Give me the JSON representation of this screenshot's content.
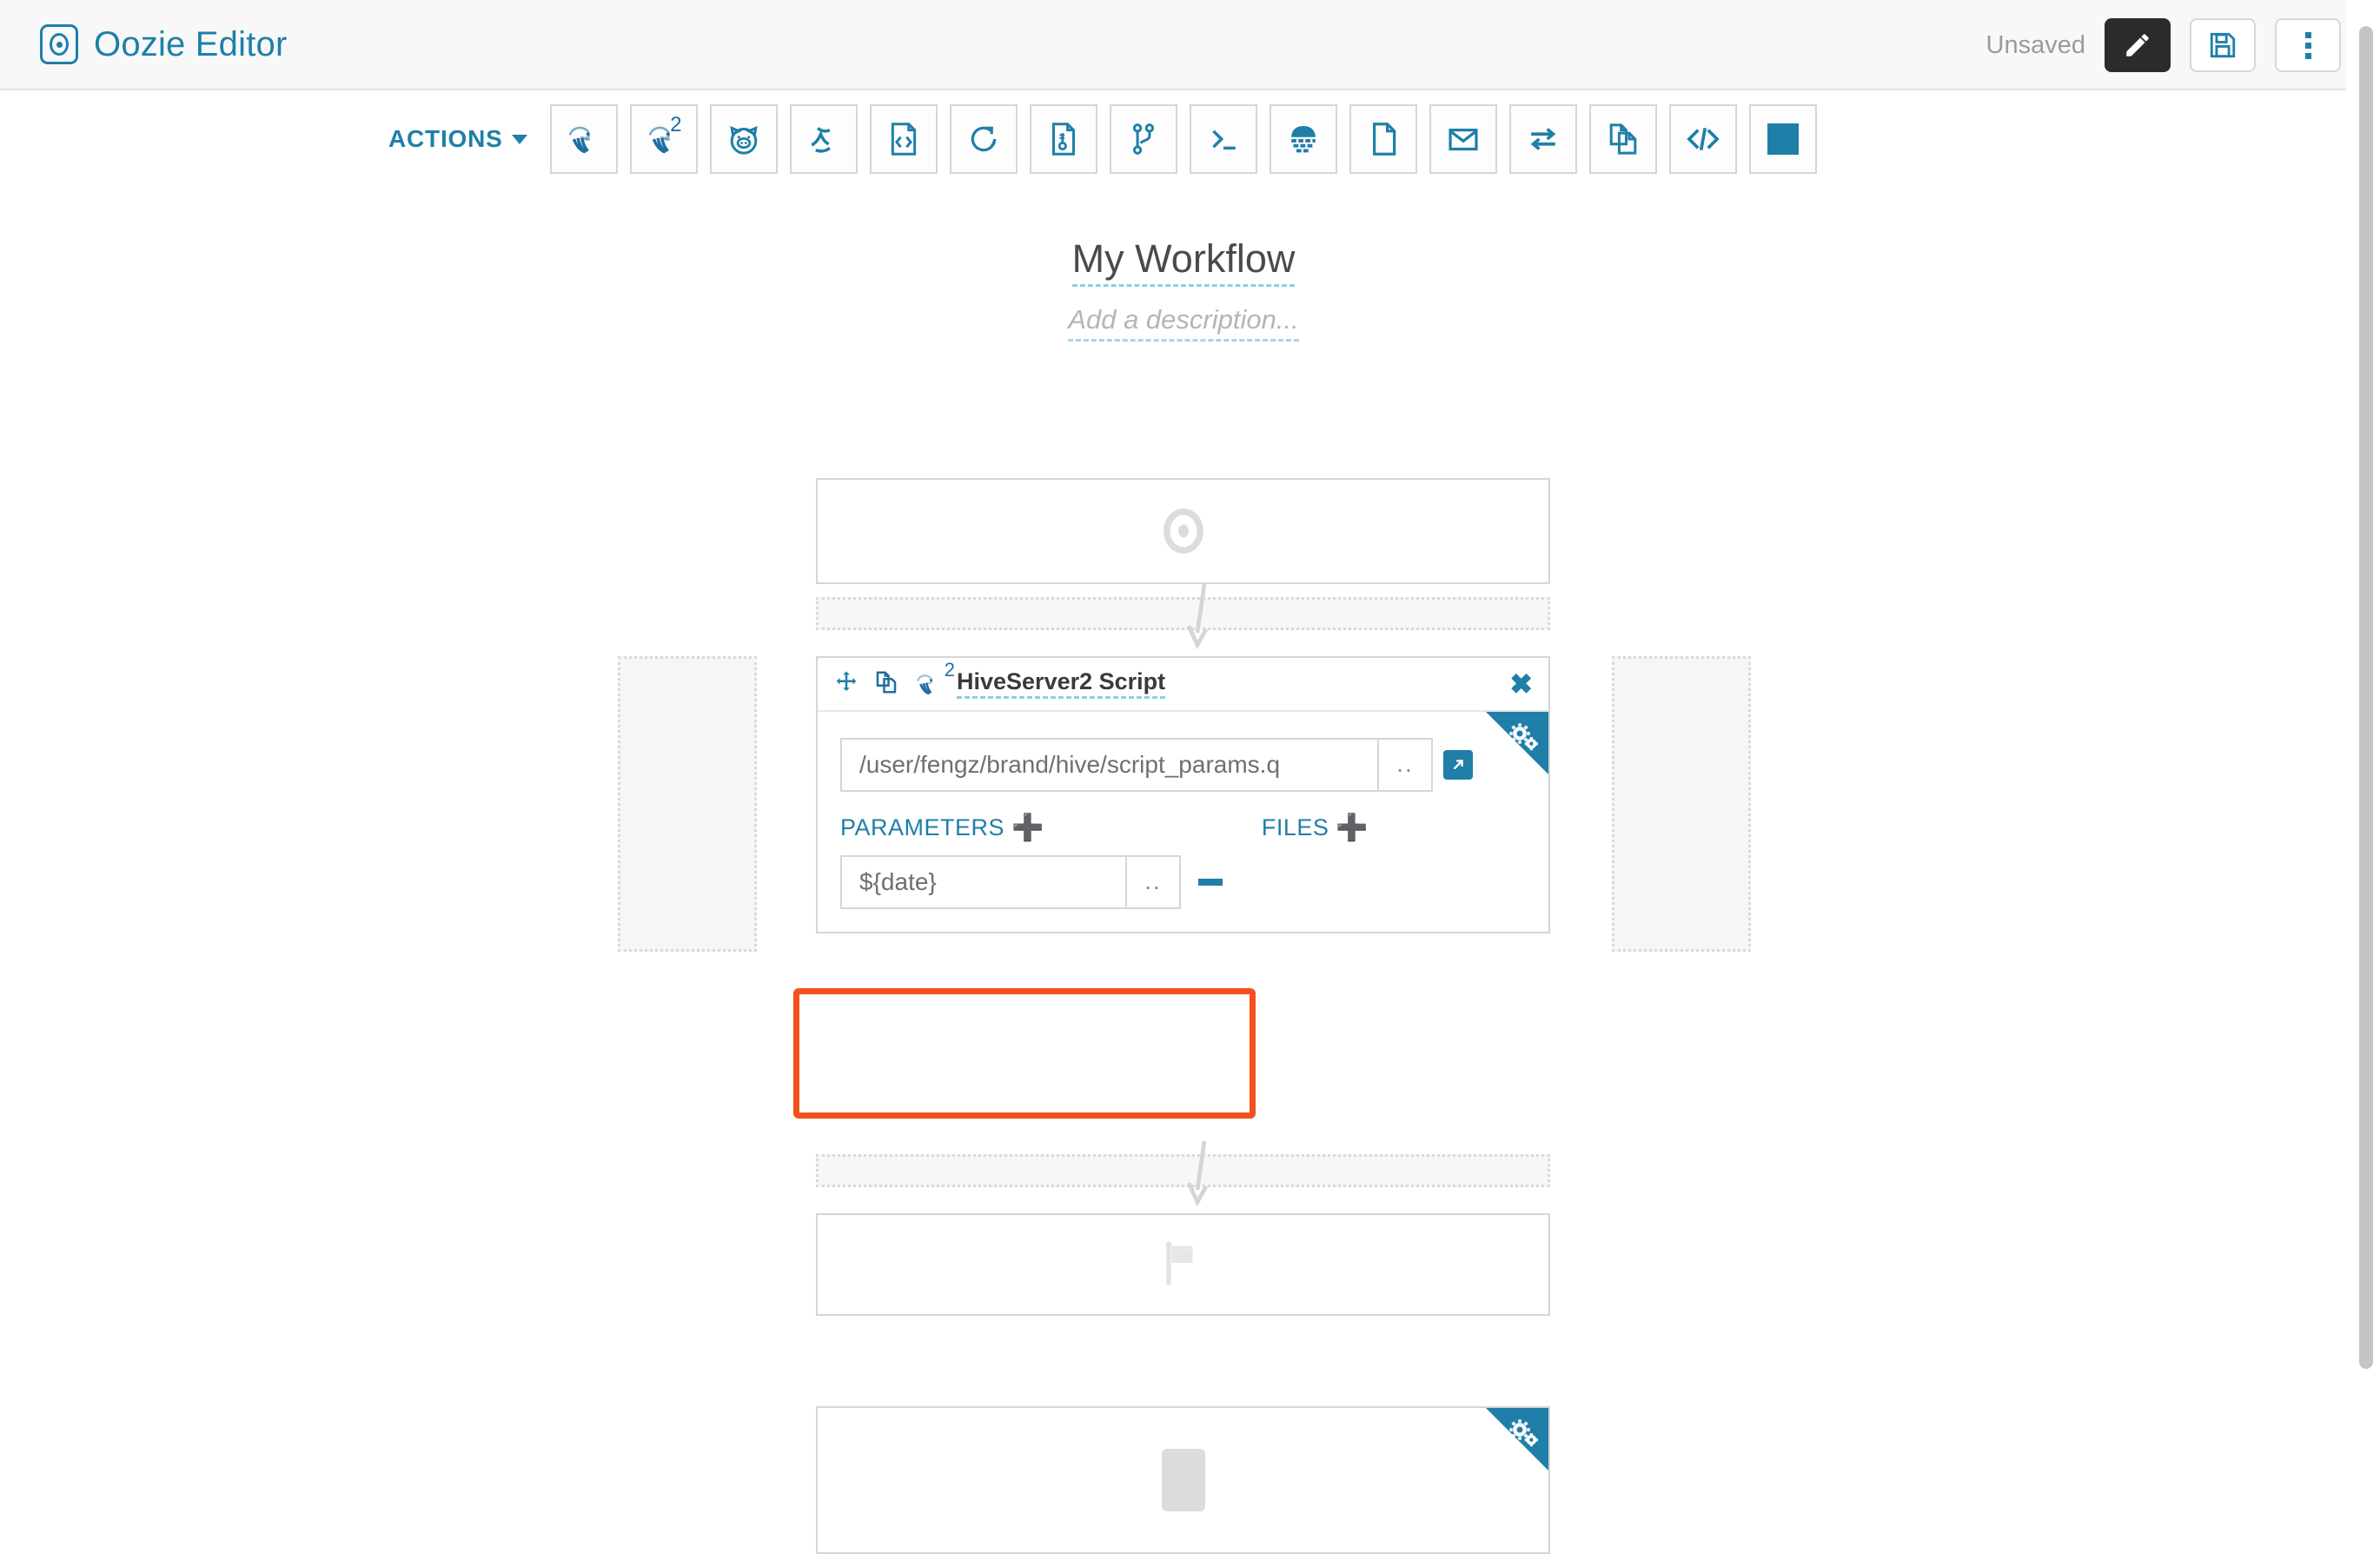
{
  "header": {
    "brand_title": "Oozie Editor",
    "brand_icon": "oozie-logo-icon",
    "status_label": "Unsaved",
    "edit_button_icon": "pencil-icon",
    "save_button_icon": "floppy-disk-icon",
    "more_button_icon": "kebab-menu-icon"
  },
  "actions_bar": {
    "label": "ACTIONS",
    "caret_icon": "chevron-down-icon",
    "items": [
      {
        "name": "hive-script-action",
        "icon": "hive-bee-icon",
        "badge": ""
      },
      {
        "name": "hiveserver2-script-action",
        "icon": "hive-bee-icon",
        "badge": "2"
      },
      {
        "name": "pig-script-action",
        "icon": "pig-head-icon",
        "badge": ""
      },
      {
        "name": "spark-action",
        "icon": "spark-icon",
        "badge": ""
      },
      {
        "name": "java-action",
        "icon": "code-document-icon",
        "badge": ""
      },
      {
        "name": "sqoop-action",
        "icon": "circle-arrow-icon",
        "badge": ""
      },
      {
        "name": "mapreduce-action",
        "icon": "document-thermometer-icon",
        "badge": ""
      },
      {
        "name": "fork-action",
        "icon": "branch-icon",
        "badge": ""
      },
      {
        "name": "shell-action",
        "icon": "terminal-prompt-icon",
        "badge": ""
      },
      {
        "name": "distcp-action",
        "icon": "keyboard-icon",
        "badge": ""
      },
      {
        "name": "fs-action",
        "icon": "blank-document-icon",
        "badge": ""
      },
      {
        "name": "email-action",
        "icon": "envelope-icon",
        "badge": ""
      },
      {
        "name": "streaming-action",
        "icon": "two-way-arrows-icon",
        "badge": ""
      },
      {
        "name": "subworkflow-action",
        "icon": "copy-documents-icon",
        "badge": ""
      },
      {
        "name": "generic-action",
        "icon": "angle-brackets-icon",
        "badge": ""
      },
      {
        "name": "kill-action",
        "icon": "filled-square-icon",
        "badge": ""
      }
    ]
  },
  "workflow": {
    "title": "My Workflow",
    "description_placeholder": "Add a description...",
    "start_node_icon": "start-target-icon",
    "end_node_icon": "checkered-flag-icon",
    "bottom_node_icon": "kill-square-icon"
  },
  "action_node": {
    "move_icon": "move-arrows-icon",
    "copy_icon": "duplicate-icon",
    "type_icon": "hive-bee-icon",
    "type_badge": "2",
    "title": "HiveServer2 Script",
    "close_icon": "close-x-icon",
    "settings_icon": "gears-icon",
    "script_path": "/user/fengz/brand/hive/script_params.q",
    "browse_label": "..",
    "external_link_icon": "external-link-icon",
    "parameters_label": "PARAMETERS",
    "parameters_add_icon": "plus-icon",
    "files_label": "FILES",
    "files_add_icon": "plus-icon",
    "parameter_value": "${date}",
    "parameter_browse_label": "..",
    "parameter_remove_icon": "minus-icon"
  },
  "colors": {
    "accent": "#1f7fa8",
    "highlight": "#f4511e",
    "header_bg": "#f8f8f8",
    "muted_text": "#9a9a9a"
  }
}
